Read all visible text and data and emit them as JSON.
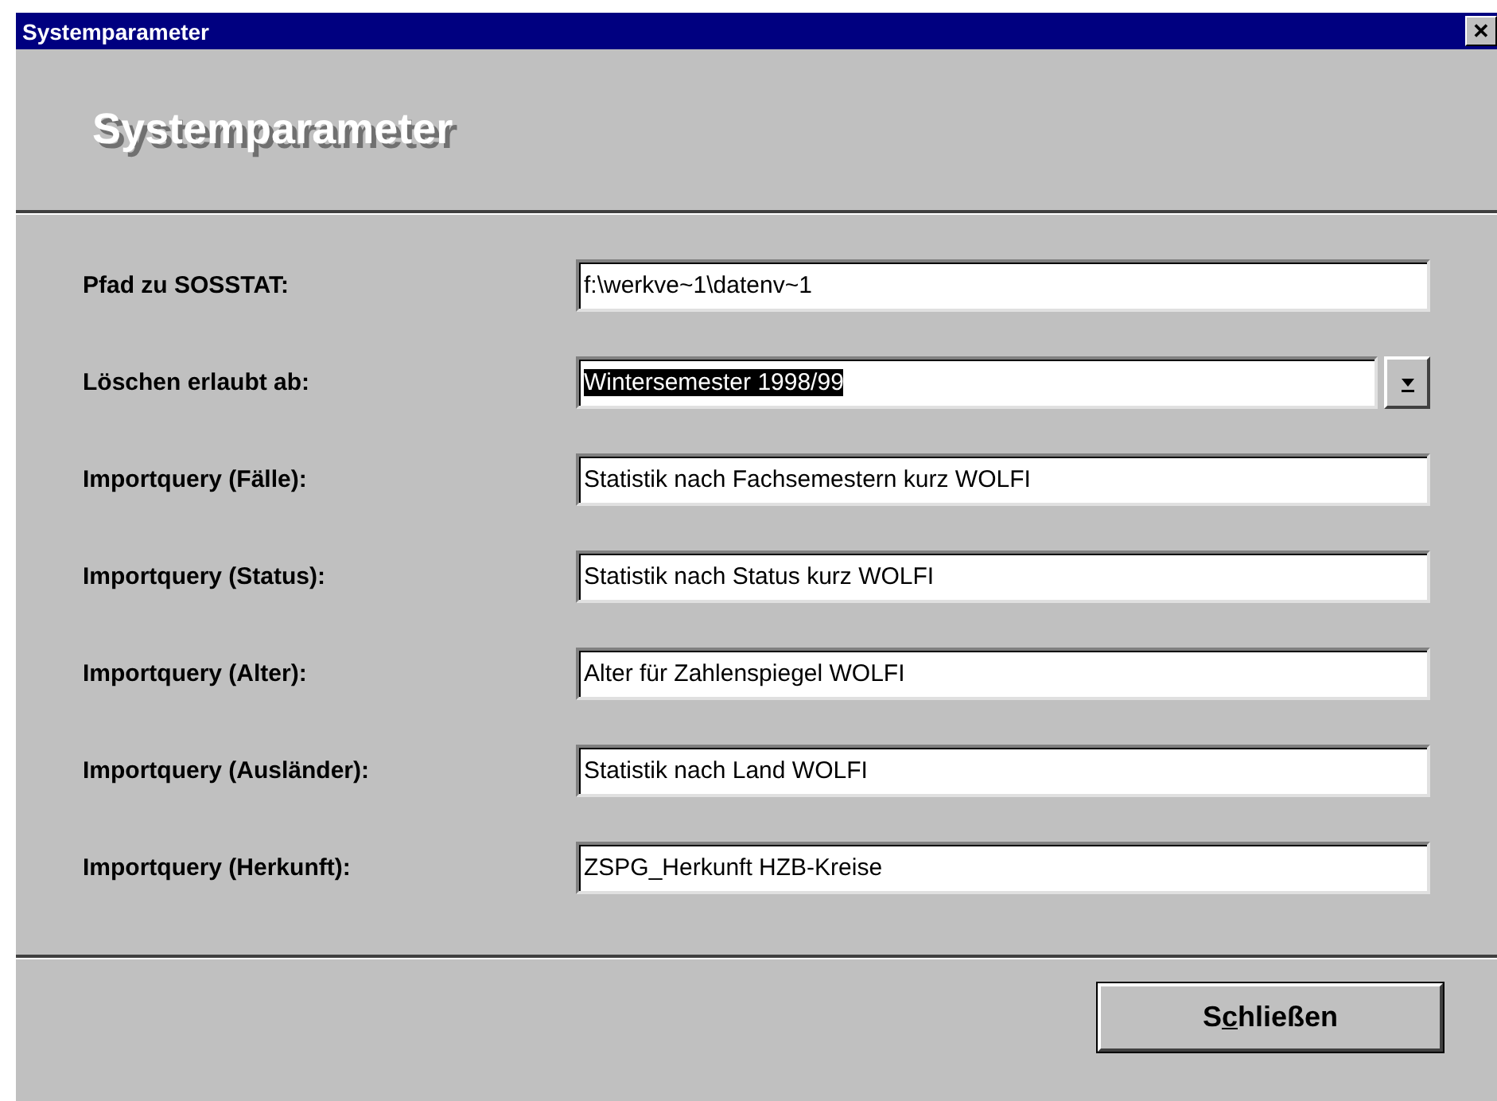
{
  "window": {
    "title": "Systemparameter",
    "close": "✕"
  },
  "heading": "Systemparameter",
  "fields": [
    {
      "kind": "text",
      "label": "Pfad zu SOSSTAT:",
      "value": "f:\\werkve~1\\datenv~1"
    },
    {
      "kind": "dropdown",
      "label": "Löschen erlaubt ab:",
      "value": "Wintersemester 1998/99",
      "highlighted": true
    },
    {
      "kind": "text",
      "label": "Importquery (Fälle):",
      "value": "Statistik nach Fachsemestern kurz WOLFI"
    },
    {
      "kind": "text",
      "label": "Importquery (Status):",
      "value": "Statistik nach Status kurz WOLFI"
    },
    {
      "kind": "text",
      "label": "Importquery (Alter):",
      "value": "Alter für Zahlenspiegel WOLFI"
    },
    {
      "kind": "text",
      "label": "Importquery (Ausländer):",
      "value": "Statistik nach Land WOLFI"
    },
    {
      "kind": "text",
      "label": "Importquery (Herkunft):",
      "value": "ZSPG_Herkunft HZB-Kreise"
    }
  ],
  "button": {
    "label_start": "S",
    "access_key": "c",
    "label_end": "hließen"
  }
}
